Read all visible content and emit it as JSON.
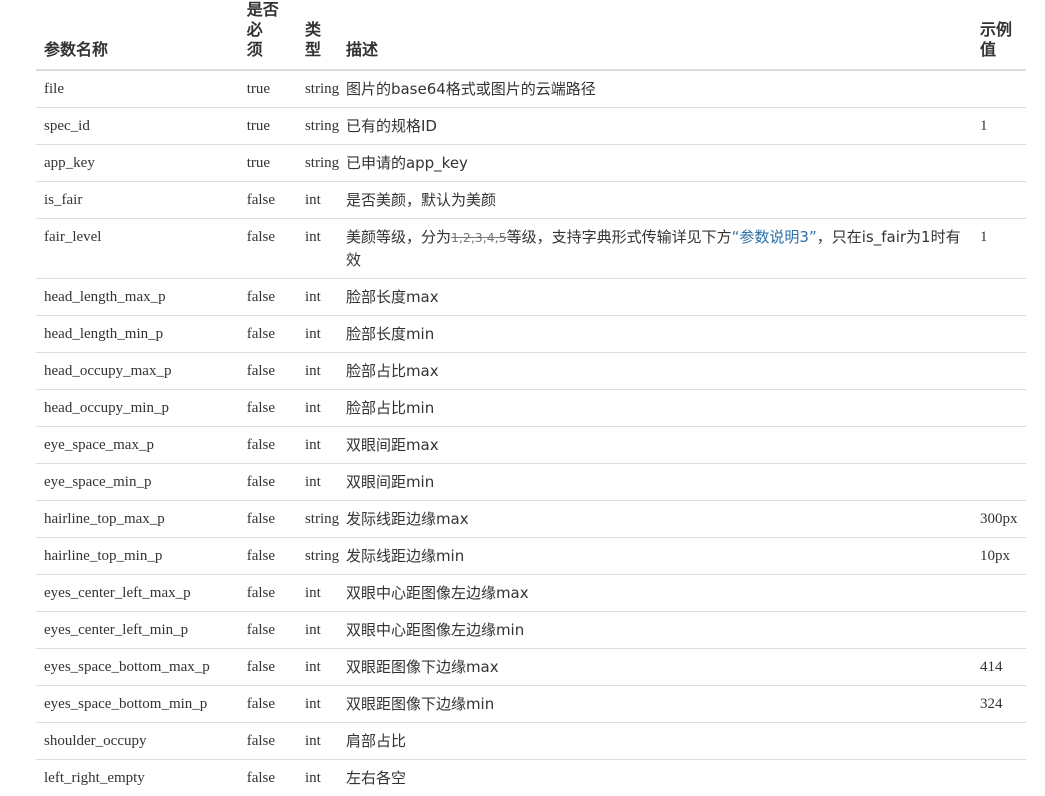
{
  "table": {
    "headers": {
      "name": "参数名称",
      "required_line1": "是否必",
      "required_line2": "须",
      "type": "类型",
      "description": "描述",
      "example_line1": "示例",
      "example_line2": "值"
    },
    "rows": [
      {
        "name": "file",
        "required": "true",
        "type": "string",
        "description": "图片的base64格式或图片的云端路径",
        "example": ""
      },
      {
        "name": "spec_id",
        "required": "true",
        "type": "string",
        "description": "已有的规格ID",
        "example": "1"
      },
      {
        "name": "app_key",
        "required": "true",
        "type": "string",
        "description": "已申请的app_key",
        "example": ""
      },
      {
        "name": "is_fair",
        "required": "false",
        "type": "int",
        "description": "是否美颜，默认为美颜",
        "example": ""
      },
      {
        "name": "fair_level",
        "required": "false",
        "type": "int",
        "description_prefix": "美颜等级，分为",
        "description_struck": "1,2,3,4,5",
        "description_middle": "等级，支持字典形式传输详见下方",
        "description_link": "“参数说明3”",
        "description_suffix": "，只在is_fair为1时有效",
        "example": "1"
      },
      {
        "name": "head_length_max_p",
        "required": "false",
        "type": "int",
        "description": "脸部长度max",
        "example": ""
      },
      {
        "name": "head_length_min_p",
        "required": "false",
        "type": "int",
        "description": "脸部长度min",
        "example": ""
      },
      {
        "name": "head_occupy_max_p",
        "required": "false",
        "type": "int",
        "description": "脸部占比max",
        "example": ""
      },
      {
        "name": "head_occupy_min_p",
        "required": "false",
        "type": "int",
        "description": "脸部占比min",
        "example": ""
      },
      {
        "name": "eye_space_max_p",
        "required": "false",
        "type": "int",
        "description": "双眼间距max",
        "example": ""
      },
      {
        "name": "eye_space_min_p",
        "required": "false",
        "type": "int",
        "description": "双眼间距min",
        "example": ""
      },
      {
        "name": "hairline_top_max_p",
        "required": "false",
        "type": "string",
        "description": "发际线距边缘max",
        "example": "300px"
      },
      {
        "name": "hairline_top_min_p",
        "required": "false",
        "type": "string",
        "description": "发际线距边缘min",
        "example": "10px"
      },
      {
        "name": "eyes_center_left_max_p",
        "required": "false",
        "type": "int",
        "description": "双眼中心距图像左边缘max",
        "example": ""
      },
      {
        "name": "eyes_center_left_min_p",
        "required": "false",
        "type": "int",
        "description": "双眼中心距图像左边缘min",
        "example": ""
      },
      {
        "name": "eyes_space_bottom_max_p",
        "required": "false",
        "type": "int",
        "description": "双眼距图像下边缘max",
        "example": "414"
      },
      {
        "name": "eyes_space_bottom_min_p",
        "required": "false",
        "type": "int",
        "description": "双眼距图像下边缘min",
        "example": "324"
      },
      {
        "name": "shoulder_occupy",
        "required": "false",
        "type": "int",
        "description": "肩部占比",
        "example": ""
      },
      {
        "name": "left_right_empty",
        "required": "false",
        "type": "int",
        "description": "左右各空",
        "example": ""
      }
    ]
  }
}
